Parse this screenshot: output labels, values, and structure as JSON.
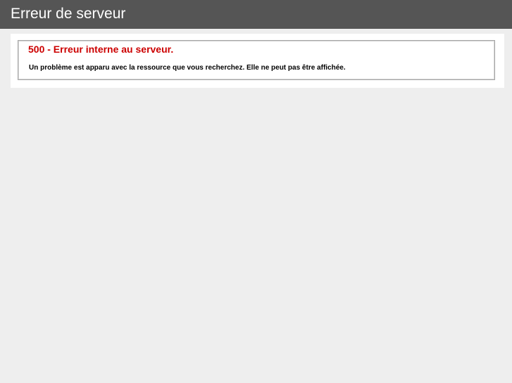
{
  "header": {
    "title": "Erreur de serveur"
  },
  "content": {
    "error_title": "500 - Erreur interne au serveur.",
    "error_message": "Un problème est apparu avec la ressource que vous recherchez. Elle ne peut pas être affichée."
  },
  "colors": {
    "header_bg": "#555555",
    "page_bg": "#EEEEEE",
    "error_title": "#CC0000"
  }
}
